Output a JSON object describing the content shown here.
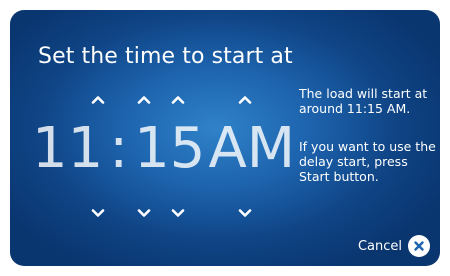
{
  "screen": {
    "title": "Set the time to start at",
    "time": {
      "hour_tens": "1",
      "hour_ones": "1",
      "separator": ":",
      "minute_tens": "1",
      "minute_ones": "5",
      "period": "AM"
    },
    "info_line_1": "The load will start at around 11:15 AM.",
    "info_line_2": "If you want to use the delay start, press Start button.",
    "cancel_label": "Cancel",
    "icons": {
      "up": "chevron-up-icon",
      "down": "chevron-down-icon",
      "cancel": "close-icon"
    },
    "colors": {
      "background": "#1d63ad",
      "text": "#ffffff",
      "cancel_icon_mark": "#1d63ad"
    }
  }
}
